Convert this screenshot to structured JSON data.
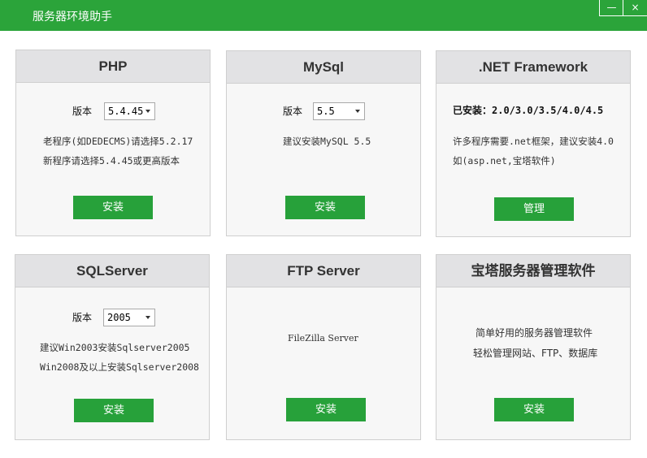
{
  "window": {
    "title": "服务器环境助手",
    "minimize_label": "—",
    "close_label": "×"
  },
  "cards": {
    "php": {
      "title": "PHP",
      "version_label": "版本",
      "version_value": "5.4.45",
      "lines": [
        "老程序(如DEDECMS)请选择5.2.17",
        "新程序请选择5.4.45或更高版本"
      ],
      "button_label": "安装"
    },
    "mysql": {
      "title": "MySql",
      "version_label": "版本",
      "version_value": "5.5",
      "lines": [
        "建议安装MySQL 5.5"
      ],
      "button_label": "安装"
    },
    "dotnet": {
      "title": ".NET Framework",
      "installed_line": "已安装：2.0/3.0/3.5/4.0/4.5",
      "lines": [
        "许多程序需要.net框架，建议安装4.0",
        "如(asp.net,宝塔软件)"
      ],
      "button_label": "管理"
    },
    "sqlserver": {
      "title": "SQLServer",
      "version_label": "版本",
      "version_value": "2005",
      "lines": [
        "建议Win2003安装Sqlserver2005",
        "Win2008及以上安装Sqlserver2008"
      ],
      "button_label": "安装"
    },
    "ftp": {
      "title": "FTP Server",
      "lines": [
        "FileZilla Server"
      ],
      "button_label": "安装"
    },
    "bt": {
      "title": "宝塔服务器管理软件",
      "lines": [
        "简单好用的服务器管理软件",
        "轻松管理网站、FTP、数据库"
      ],
      "button_label": "安装"
    }
  }
}
